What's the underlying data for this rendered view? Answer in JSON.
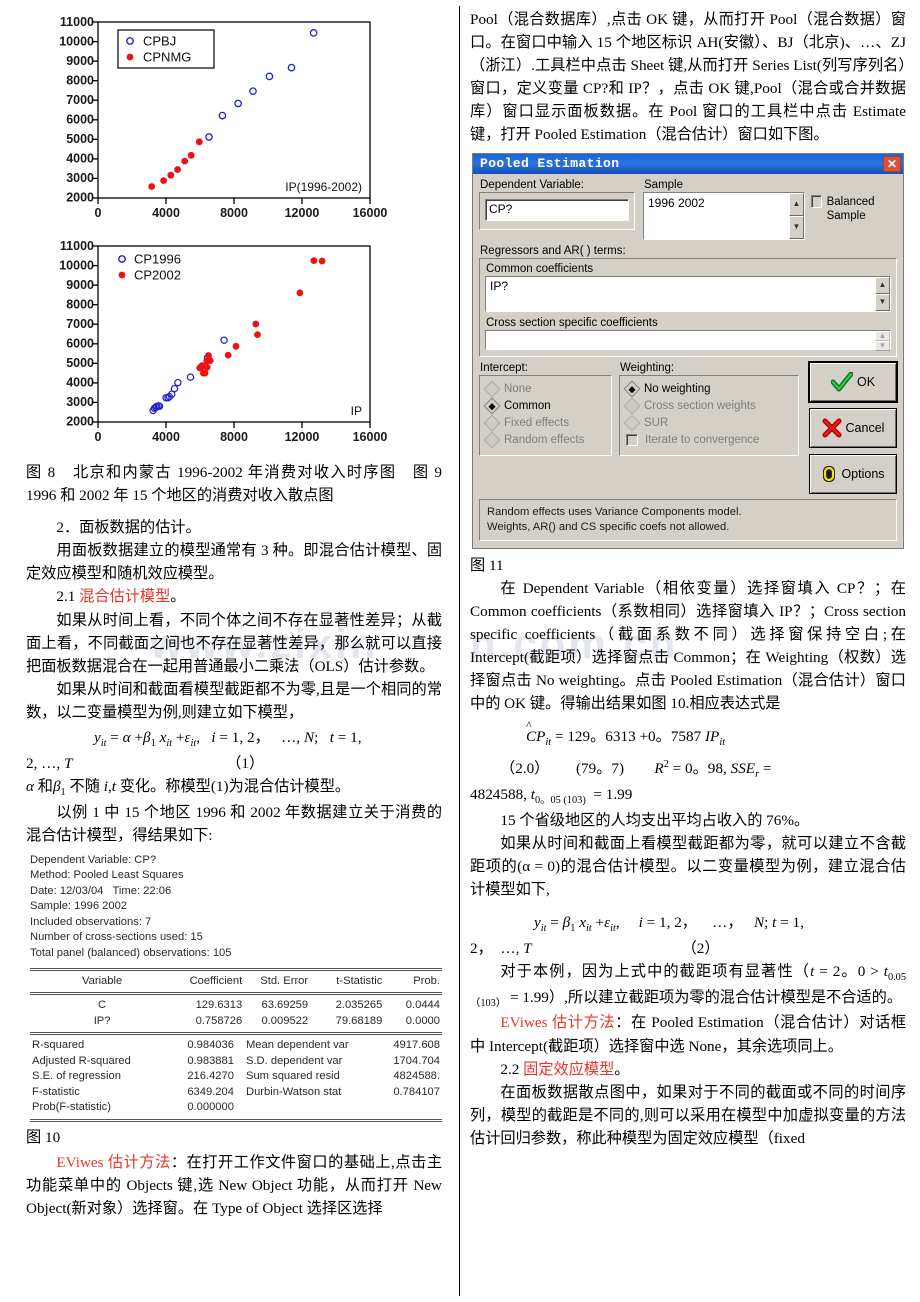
{
  "watermark": {
    "left": "www.zixin",
    "right": "n.com.cn"
  },
  "chart_data": [
    {
      "type": "scatter",
      "title": "",
      "xlabel": "IP(1996-2002)",
      "ylabel": "",
      "xlim": [
        0,
        16000
      ],
      "ylim": [
        2000,
        11000
      ],
      "xticks": [
        0,
        4000,
        8000,
        12000,
        16000
      ],
      "yticks": [
        2000,
        3000,
        4000,
        5000,
        6000,
        7000,
        8000,
        9000,
        10000,
        11000
      ],
      "grid": false,
      "legend_position": "top-left",
      "series": [
        {
          "name": "CPBJ",
          "marker": "open-circle",
          "color": "#2222cc",
          "points": [
            [
              6530,
              5120
            ],
            [
              7320,
              6220
            ],
            [
              8240,
              6840
            ],
            [
              9120,
              7470
            ],
            [
              10080,
              8230
            ],
            [
              11380,
              8680
            ],
            [
              12680,
              10460
            ]
          ]
        },
        {
          "name": "CPNMG",
          "marker": "filled-circle",
          "color": "#ee1111",
          "points": [
            [
              3160,
              2580
            ],
            [
              3860,
              2880
            ],
            [
              4280,
              3160
            ],
            [
              4680,
              3450
            ],
            [
              5100,
              3880
            ],
            [
              5480,
              4180
            ],
            [
              5960,
              4870
            ]
          ]
        }
      ]
    },
    {
      "type": "scatter",
      "title": "",
      "xlabel": "IP",
      "ylabel": "",
      "xlim": [
        0,
        16000
      ],
      "ylim": [
        2000,
        11000
      ],
      "xticks": [
        0,
        4000,
        8000,
        12000,
        16000
      ],
      "yticks": [
        2000,
        3000,
        4000,
        5000,
        6000,
        7000,
        8000,
        9000,
        10000,
        11000
      ],
      "grid": false,
      "legend_position": "top-left",
      "series": [
        {
          "name": "CP1996",
          "marker": "open-circle",
          "color": "#2222cc",
          "points": [
            [
              3240,
              2580
            ],
            [
              3320,
              2700
            ],
            [
              3400,
              2740
            ],
            [
              3460,
              2790
            ],
            [
              3560,
              2810
            ],
            [
              3620,
              2800
            ],
            [
              4000,
              3230
            ],
            [
              4120,
              3230
            ],
            [
              4200,
              3290
            ],
            [
              4340,
              3420
            ],
            [
              4500,
              3700
            ],
            [
              4700,
              4010
            ],
            [
              5440,
              4290
            ],
            [
              6440,
              5280
            ],
            [
              7420,
              6180
            ]
          ]
        },
        {
          "name": "CP2002",
          "marker": "filled-circle",
          "color": "#ee1111",
          "points": [
            [
              5980,
              4760
            ],
            [
              6060,
              4790
            ],
            [
              6120,
              4880
            ],
            [
              6200,
              4490
            ],
            [
              6300,
              4500
            ],
            [
              6400,
              5120
            ],
            [
              6420,
              4790
            ],
            [
              6500,
              5380
            ],
            [
              6600,
              5100
            ],
            [
              7660,
              5610
            ],
            [
              8120,
              6060
            ],
            [
              9280,
              7200
            ],
            [
              9380,
              6660
            ],
            [
              11880,
              8790
            ],
            [
              12700,
              10450
            ],
            [
              13180,
              10430
            ]
          ]
        }
      ]
    }
  ],
  "figure_caption": "图 8　北京和内蒙古 1996-2002 年消费对收入时序图　图 9　1996 和 2002 年 15 个地区的消费对收入散点图",
  "left_column": {
    "section_2_heading": "2．面板数据的估计。",
    "para_models": "用面板数据建立的模型通常有 3 种。即混合估计模型、固定效应模型和随机效应模型。",
    "sub_2_1_num": "2.1",
    "sub_2_1_title": "混合估计模型",
    "sub_2_1_tail": "。",
    "para_pooled_1": "如果从时间上看，不同个体之间不存在显著性差异；从截面上看，不同截面之间也不存在显著性差异，那么就可以直接把面板数据混合在一起用普通最小二乘法（OLS）估计参数。",
    "para_pooled_2": "如果从时间和截面看模型截距都不为零,且是一个相同的常数，以二变量模型为例,则建立如下模型，",
    "eq1_body": "y",
    "eq1_text": "yit = α +β1 xit +εit,　i = 1, 2,　…, N;　t = 1, 2, …, T",
    "eq1_number": "（1）",
    "para_after_eq1": "α 和β1 不随 i,t 变化。称模型(1)为混合估计模型。",
    "para_example": "以例 1 中 15 个地区 1996 和 2002 年数据建立关于消费的混合估计模型，得结果如下:",
    "eviews_header": [
      "Dependent Variable: CP?",
      "Method: Pooled Least Squares",
      "Date: 12/03/04   Time: 22:06",
      "Sample: 1996 2002",
      "Included observations: 7",
      "Number of cross-sections used: 15",
      "Total panel (balanced) observations: 105"
    ],
    "eviews_columns": [
      "Variable",
      "Coefficient",
      "Std. Error",
      "t-Statistic",
      "Prob."
    ],
    "eviews_rows": [
      [
        "C",
        "129.6313",
        "63.69259",
        "2.035265",
        "0.0444"
      ],
      [
        "IP?",
        "0.758726",
        "0.009522",
        "79.68189",
        "0.0000"
      ]
    ],
    "eviews_stats": [
      [
        "R-squared",
        "0.984036",
        "Mean dependent var",
        "4917.608"
      ],
      [
        "Adjusted R-squared",
        "0.983881",
        "S.D. dependent var",
        "1704.704"
      ],
      [
        "S.E. of regression",
        "216.4270",
        "Sum squared resid",
        "4824588."
      ],
      [
        "F-statistic",
        "6349.204",
        "Durbin-Watson stat",
        "0.784107"
      ],
      [
        "Prob(F-statistic)",
        "0.000000",
        "",
        ""
      ]
    ],
    "fig10_caption": "图 10",
    "eviews_method_label": "EViwes 估计方法",
    "eviews_method_text": "：在打开工作文件窗口的基础上,点击主功能菜单中的 Objects 键,选 New Object 功能，从而打开 New Object(新对象）选择窗。在 Type of Object 选择区选择"
  },
  "right_column": {
    "para_top": "Pool（混合数据库）,点击 OK 键，从而打开 Pool（混合数据）窗口。在窗口中输入 15 个地区标识 AH(安徽）、BJ（北京)、…、ZJ（浙江）.工具栏中点击 Sheet 键,从而打开 Series List(列写序列名）窗口，定义变量 CP?和 IP？，点击 OK 键,Pool（混合或合并数据库）窗口显示面板数据。在 Pool 窗口的工具栏中点击 Estimate 键，打开 Pooled Estimation（混合估计）窗口如下图。",
    "dialog": {
      "title": "Pooled Estimation",
      "close_label": "✕",
      "dependent_variable_label": "Dependent Variable:",
      "dependent_variable_value": "CP?",
      "sample_label": "Sample",
      "sample_value": "1996 2002",
      "balanced_sample_label": "Balanced Sample",
      "balanced_sample_checked": false,
      "regressors_label": "Regressors and AR( ) terms:",
      "common_coefficients_label": "Common coefficients",
      "common_coefficients_value": "IP?",
      "cross_section_label": "Cross section specific coefficients",
      "cross_section_value": "",
      "intercept_label": "Intercept:",
      "intercept_options": [
        {
          "label": "None",
          "selected": false,
          "disabled": true
        },
        {
          "label": "Common",
          "selected": true,
          "disabled": false
        },
        {
          "label": "Fixed effects",
          "selected": false,
          "disabled": true
        },
        {
          "label": "Random effects",
          "selected": false,
          "disabled": true
        }
      ],
      "weighting_label": "Weighting:",
      "weighting_options": [
        {
          "label": "No weighting",
          "selected": true,
          "disabled": false
        },
        {
          "label": "Cross section weights",
          "selected": false,
          "disabled": true
        },
        {
          "label": "SUR",
          "selected": false,
          "disabled": true
        }
      ],
      "iterate_label": "Iterate to convergence",
      "iterate_checked": false,
      "note_line1": "Random effects uses Variance Components model.",
      "note_line2": "Weights, AR() and CS specific coefs not allowed.",
      "ok_label": "OK",
      "cancel_label": "Cancel",
      "options_label": "Options"
    },
    "fig11_caption": "图 11",
    "para_instructions": "在 Dependent Variable（相依变量）选择窗填入 CP？；在 Common coefficients（系数相同）选择窗填入 IP？；Cross section specific coefficients（截面系数不同）选择窗保持空白;在 Intercept(截距项）选择窗点击 Common；在 Weighting（权数）选择窗点击 No weighting。点击 Pooled Estimation（混合估计）窗口中的 OK 键。得输出结果如图 10.相应表达式是",
    "eq_result": "CP̂it = 129。6313 +0。7587 IPit",
    "eq_stats_line1": "（2.0）　　　(79。7)　　　R2 = 0。98, SSEr = 4824588, t0。05 (103) = 1.99",
    "para_76": "15 个省级地区的人均支出平均占收入的 76%。",
    "para_zero_intercept": "如果从时间和截面上看模型截距都为零，就可以建立不含截距项的(α = 0)的混合估计模型。以二变量模型为例，建立混合估计模型如下,",
    "eq2_text": "yit = β1 xit +εit,　　i = 1, 2,　…,　N; t = 1, 2,　…, T",
    "eq2_number": "（2）",
    "para_sig": "对于本例，因为上式中的截距项有显著性（t = 2。0 > t0.05（103） = 1.99）,所以建立截距项为零的混合估计模型是不合适的。",
    "eviews_method_label": "EViwes 估计方法",
    "eviews_method_text": "：在 Pooled Estimation（混合估计）对话框中 Intercept(截距项）选择窗中选 None，其余选项同上。",
    "sub_2_2_num": "2.2",
    "sub_2_2_title": "固定效应模型",
    "sub_2_2_tail": "。",
    "para_fixed": "在面板数据散点图中，如果对于不同的截面或不同的时间序列，模型的截距是不同的,则可以采用在模型中加虚拟变量的方法估计回归参数，称此种模型为固定效应模型（fixed"
  }
}
